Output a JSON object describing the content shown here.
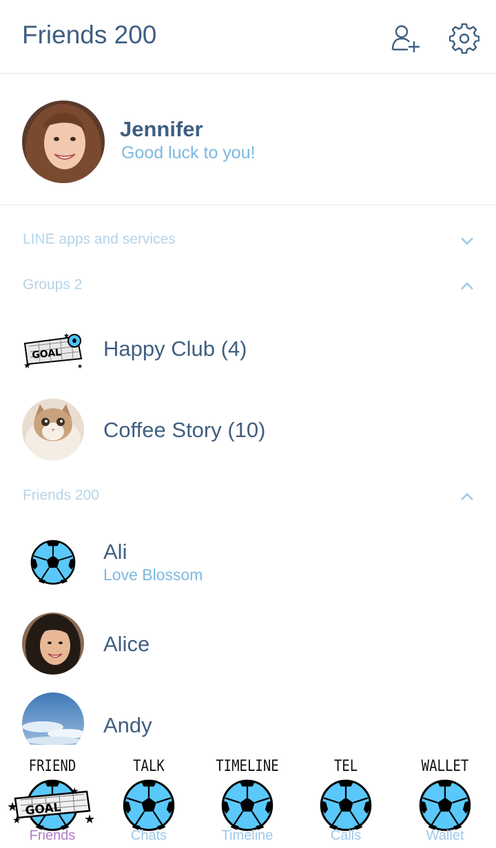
{
  "header": {
    "title": "Friends 200",
    "icons": [
      "add-friend-icon",
      "settings-gear-icon"
    ]
  },
  "profile": {
    "name": "Jennifer",
    "status": "Good luck to you!"
  },
  "sections": {
    "services": {
      "label": "LINE apps and services",
      "state": "collapsed"
    },
    "groups": {
      "label": "Groups 2",
      "state": "expanded"
    },
    "friends": {
      "label": "Friends 200",
      "state": "expanded"
    }
  },
  "groups": [
    {
      "name": "Happy Club (4)",
      "avatar": "goal-sticker-icon"
    },
    {
      "name": "Coffee Story (10)",
      "avatar": "cat-photo"
    }
  ],
  "friends": [
    {
      "name": "Ali",
      "status": "Love Blossom",
      "avatar": "soccer-ball-icon"
    },
    {
      "name": "Alice",
      "status": "",
      "avatar": "woman-photo"
    },
    {
      "name": "Andy",
      "status": "",
      "avatar": "sky-photo"
    }
  ],
  "tabs": [
    {
      "top": "FRIEND",
      "label": "Friends",
      "active": true
    },
    {
      "top": "TALK",
      "label": "Chats",
      "active": false
    },
    {
      "top": "TIMELINE",
      "label": "Timeline",
      "active": false
    },
    {
      "top": "TEL",
      "label": "Calls",
      "active": false
    },
    {
      "top": "WALLET",
      "label": "Wallet",
      "active": false
    }
  ],
  "colors": {
    "title": "#3f5f80",
    "status": "#7cb8e0",
    "section": "#b4d4ea",
    "active_tab": "#b07cc6",
    "inactive_tab": "#9cc8e8",
    "ball_blue": "#4fc3f7"
  }
}
